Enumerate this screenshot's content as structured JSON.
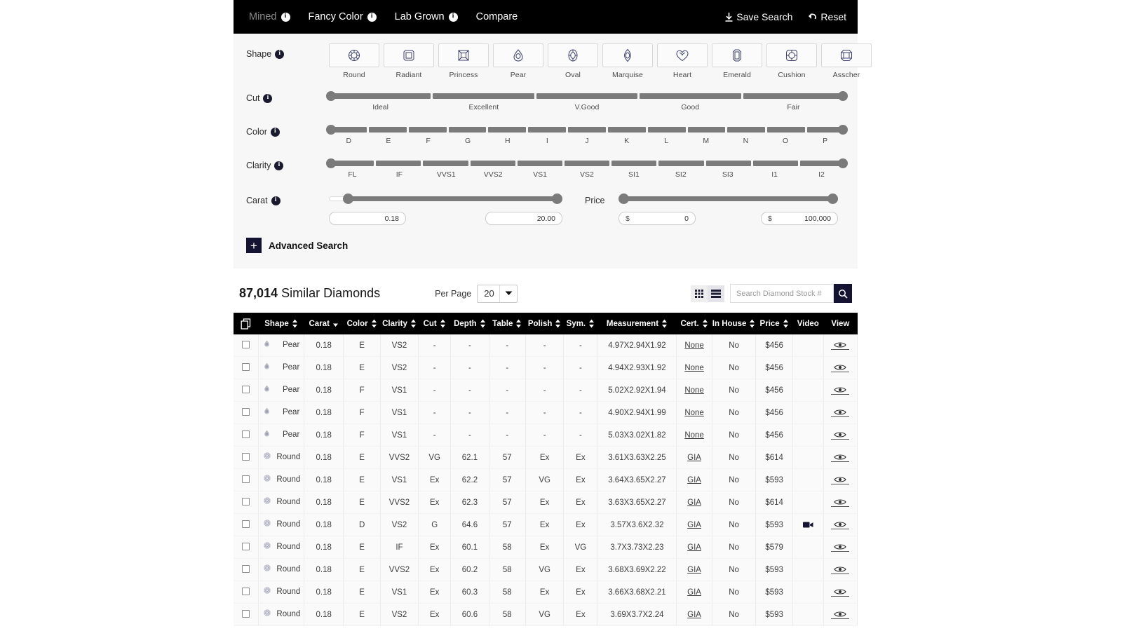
{
  "topnav": {
    "items": [
      {
        "label": "Mined",
        "info": true,
        "dim": true
      },
      {
        "label": "Fancy Color",
        "info": true,
        "dim": false
      },
      {
        "label": "Lab Grown",
        "info": true,
        "dim": false
      },
      {
        "label": "Compare",
        "info": false,
        "dim": false
      }
    ],
    "actions": [
      {
        "label": "Save Search",
        "icon": "download-arrow-icon"
      },
      {
        "label": "Reset",
        "icon": "undo-arrow-icon"
      }
    ]
  },
  "filters": {
    "shape": {
      "label": "Shape",
      "options": [
        {
          "name": "Round",
          "icon": "round-diamond-icon"
        },
        {
          "name": "Radiant",
          "icon": "radiant-diamond-icon"
        },
        {
          "name": "Princess",
          "icon": "princess-diamond-icon"
        },
        {
          "name": "Pear",
          "icon": "pear-diamond-icon"
        },
        {
          "name": "Oval",
          "icon": "oval-diamond-icon"
        },
        {
          "name": "Marquise",
          "icon": "marquise-diamond-icon"
        },
        {
          "name": "Heart",
          "icon": "heart-diamond-icon"
        },
        {
          "name": "Emerald",
          "icon": "emerald-diamond-icon"
        },
        {
          "name": "Cushion",
          "icon": "cushion-diamond-icon"
        },
        {
          "name": "Asscher",
          "icon": "asscher-diamond-icon"
        }
      ]
    },
    "cut": {
      "label": "Cut",
      "ticks": [
        "Ideal",
        "Excellent",
        "V.Good",
        "Good",
        "Fair"
      ]
    },
    "color": {
      "label": "Color",
      "ticks": [
        "D",
        "E",
        "F",
        "G",
        "H",
        "I",
        "J",
        "K",
        "L",
        "M",
        "N",
        "O",
        "P"
      ]
    },
    "clarity": {
      "label": "Clarity",
      "ticks": [
        "FL",
        "IF",
        "VVS1",
        "VVS2",
        "VS1",
        "VS2",
        "SI1",
        "SI2",
        "SI3",
        "I1",
        "I2"
      ]
    },
    "carat": {
      "label": "Carat",
      "min_value": "0.18",
      "max_value": "20.00"
    },
    "price": {
      "label": "Price",
      "currency": "$",
      "min_value": "0",
      "max_value": "100,000"
    },
    "advanced_search": "Advanced Search"
  },
  "results": {
    "count": "87,014",
    "count_label": "Similar Diamonds",
    "per_page_label": "Per Page",
    "per_page_value": "20",
    "search_placeholder": "Search Diamond Stock #",
    "view_grid_icon": "grid-view-icon",
    "view_list_icon": "list-view-icon",
    "search_icon": "search-icon"
  },
  "table": {
    "columns": [
      {
        "label": "",
        "sort": "none",
        "icon": "copy-icon"
      },
      {
        "label": "Shape",
        "sort": "both"
      },
      {
        "label": "Carat",
        "sort": "desc"
      },
      {
        "label": "Color",
        "sort": "both"
      },
      {
        "label": "Clarity",
        "sort": "both"
      },
      {
        "label": "Cut",
        "sort": "both"
      },
      {
        "label": "Depth",
        "sort": "both"
      },
      {
        "label": "Table",
        "sort": "both"
      },
      {
        "label": "Polish",
        "sort": "both"
      },
      {
        "label": "Sym.",
        "sort": "both"
      },
      {
        "label": "Measurement",
        "sort": "both"
      },
      {
        "label": "Cert.",
        "sort": "both"
      },
      {
        "label": "In House",
        "sort": "both"
      },
      {
        "label": "Price",
        "sort": "both"
      },
      {
        "label": "Video",
        "sort": "none"
      },
      {
        "label": "View",
        "sort": "none"
      }
    ],
    "rows": [
      {
        "shape": "Pear",
        "shape_icon": "pear-diamond-icon",
        "carat": "0.18",
        "color": "E",
        "clarity": "VS2",
        "cut": "-",
        "depth": "-",
        "table": "-",
        "polish": "-",
        "sym": "-",
        "measurement": "4.97X2.94X1.92",
        "cert": "None",
        "in_house": "No",
        "price": "$456",
        "video": false
      },
      {
        "shape": "Pear",
        "shape_icon": "pear-diamond-icon",
        "carat": "0.18",
        "color": "E",
        "clarity": "VS2",
        "cut": "-",
        "depth": "-",
        "table": "-",
        "polish": "-",
        "sym": "-",
        "measurement": "4.94X2.93X1.92",
        "cert": "None",
        "in_house": "No",
        "price": "$456",
        "video": false
      },
      {
        "shape": "Pear",
        "shape_icon": "pear-diamond-icon",
        "carat": "0.18",
        "color": "F",
        "clarity": "VS1",
        "cut": "-",
        "depth": "-",
        "table": "-",
        "polish": "-",
        "sym": "-",
        "measurement": "5.02X2.92X1.94",
        "cert": "None",
        "in_house": "No",
        "price": "$456",
        "video": false
      },
      {
        "shape": "Pear",
        "shape_icon": "pear-diamond-icon",
        "carat": "0.18",
        "color": "F",
        "clarity": "VS1",
        "cut": "-",
        "depth": "-",
        "table": "-",
        "polish": "-",
        "sym": "-",
        "measurement": "4.90X2.94X1.99",
        "cert": "None",
        "in_house": "No",
        "price": "$456",
        "video": false
      },
      {
        "shape": "Pear",
        "shape_icon": "pear-diamond-icon",
        "carat": "0.18",
        "color": "F",
        "clarity": "VS1",
        "cut": "-",
        "depth": "-",
        "table": "-",
        "polish": "-",
        "sym": "-",
        "measurement": "5.03X3.02X1.82",
        "cert": "None",
        "in_house": "No",
        "price": "$456",
        "video": false
      },
      {
        "shape": "Round",
        "shape_icon": "round-diamond-icon",
        "carat": "0.18",
        "color": "E",
        "clarity": "VVS2",
        "cut": "VG",
        "depth": "62.1",
        "table": "57",
        "polish": "Ex",
        "sym": "Ex",
        "measurement": "3.61X3.63X2.25",
        "cert": "GIA",
        "in_house": "No",
        "price": "$614",
        "video": false
      },
      {
        "shape": "Round",
        "shape_icon": "round-diamond-icon",
        "carat": "0.18",
        "color": "E",
        "clarity": "VS1",
        "cut": "Ex",
        "depth": "62.2",
        "table": "57",
        "polish": "VG",
        "sym": "Ex",
        "measurement": "3.64X3.65X2.27",
        "cert": "GIA",
        "in_house": "No",
        "price": "$593",
        "video": false
      },
      {
        "shape": "Round",
        "shape_icon": "round-diamond-icon",
        "carat": "0.18",
        "color": "E",
        "clarity": "VVS2",
        "cut": "Ex",
        "depth": "62.3",
        "table": "57",
        "polish": "Ex",
        "sym": "Ex",
        "measurement": "3.63X3.65X2.27",
        "cert": "GIA",
        "in_house": "No",
        "price": "$614",
        "video": false
      },
      {
        "shape": "Round",
        "shape_icon": "round-diamond-icon",
        "carat": "0.18",
        "color": "D",
        "clarity": "VS2",
        "cut": "G",
        "depth": "64.6",
        "table": "57",
        "polish": "Ex",
        "sym": "Ex",
        "measurement": "3.57X3.6X2.32",
        "cert": "GIA",
        "in_house": "No",
        "price": "$593",
        "video": true
      },
      {
        "shape": "Round",
        "shape_icon": "round-diamond-icon",
        "carat": "0.18",
        "color": "E",
        "clarity": "IF",
        "cut": "Ex",
        "depth": "60.1",
        "table": "58",
        "polish": "Ex",
        "sym": "VG",
        "measurement": "3.7X3.73X2.23",
        "cert": "GIA",
        "in_house": "No",
        "price": "$579",
        "video": false
      },
      {
        "shape": "Round",
        "shape_icon": "round-diamond-icon",
        "carat": "0.18",
        "color": "E",
        "clarity": "VVS2",
        "cut": "Ex",
        "depth": "60.2",
        "table": "58",
        "polish": "VG",
        "sym": "Ex",
        "measurement": "3.68X3.69X2.22",
        "cert": "GIA",
        "in_house": "No",
        "price": "$593",
        "video": false
      },
      {
        "shape": "Round",
        "shape_icon": "round-diamond-icon",
        "carat": "0.18",
        "color": "E",
        "clarity": "VS1",
        "cut": "Ex",
        "depth": "60.3",
        "table": "58",
        "polish": "Ex",
        "sym": "Ex",
        "measurement": "3.66X3.68X2.21",
        "cert": "GIA",
        "in_house": "No",
        "price": "$593",
        "video": false
      },
      {
        "shape": "Round",
        "shape_icon": "round-diamond-icon",
        "carat": "0.18",
        "color": "E",
        "clarity": "VS2",
        "cut": "Ex",
        "depth": "60.6",
        "table": "58",
        "polish": "VG",
        "sym": "Ex",
        "measurement": "3.69X3.7X2.24",
        "cert": "GIA",
        "in_house": "No",
        "price": "$593",
        "video": false
      }
    ]
  },
  "colors": {
    "nav_bg": "#000000",
    "panel_bg": "#f7f7f7",
    "slider_gray": "#7b7b7b",
    "accent_navy": "#141432",
    "icon_navy": "#3a3f6b"
  }
}
